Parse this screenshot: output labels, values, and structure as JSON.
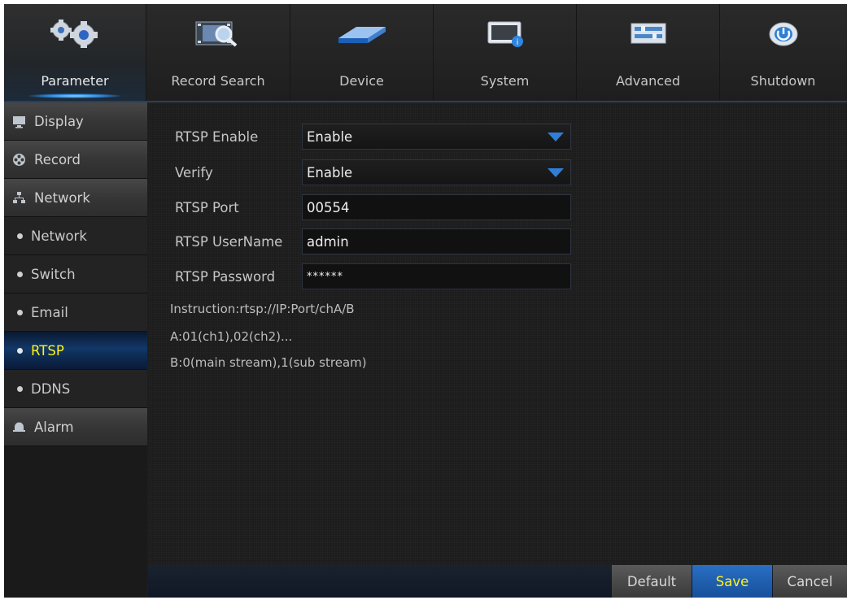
{
  "nav": {
    "items": [
      {
        "label": "Parameter",
        "icon": "gears-icon",
        "active": true
      },
      {
        "label": "Record Search",
        "icon": "film-search-icon"
      },
      {
        "label": "Device",
        "icon": "hard-disk-icon"
      },
      {
        "label": "System",
        "icon": "monitor-info-icon"
      },
      {
        "label": "Advanced",
        "icon": "advanced-panel-icon"
      },
      {
        "label": "Shutdown",
        "icon": "power-icon"
      }
    ]
  },
  "sidebar": {
    "items": [
      {
        "label": "Display",
        "type": "category",
        "icon": "monitor-icon"
      },
      {
        "label": "Record",
        "type": "category",
        "icon": "film-reel-icon"
      },
      {
        "label": "Network",
        "type": "category",
        "icon": "network-icon"
      },
      {
        "label": "Network",
        "type": "sub"
      },
      {
        "label": "Switch",
        "type": "sub"
      },
      {
        "label": "Email",
        "type": "sub"
      },
      {
        "label": "RTSP",
        "type": "sub",
        "active": true
      },
      {
        "label": "DDNS",
        "type": "sub"
      },
      {
        "label": "Alarm",
        "type": "category",
        "icon": "alarm-bell-icon"
      }
    ]
  },
  "form": {
    "rtsp_enable": {
      "label": "RTSP Enable",
      "value": "Enable"
    },
    "verify": {
      "label": "Verify",
      "value": "Enable"
    },
    "rtsp_port": {
      "label": "RTSP Port",
      "value": "00554"
    },
    "rtsp_username": {
      "label": "RTSP UserName",
      "value": "admin"
    },
    "rtsp_password": {
      "label": "RTSP Password",
      "value": "******"
    }
  },
  "info": {
    "instruction": "Instruction:rtsp://IP:Port/chA/B",
    "line_a": "A:01(ch1),02(ch2)...",
    "line_b": "B:0(main stream),1(sub stream)"
  },
  "buttons": {
    "default": "Default",
    "save": "Save",
    "cancel": "Cancel"
  },
  "colors": {
    "accent_blue": "#1f5fb0",
    "active_text": "#fff21a",
    "dropdown_arrow": "#2f7fd6"
  }
}
